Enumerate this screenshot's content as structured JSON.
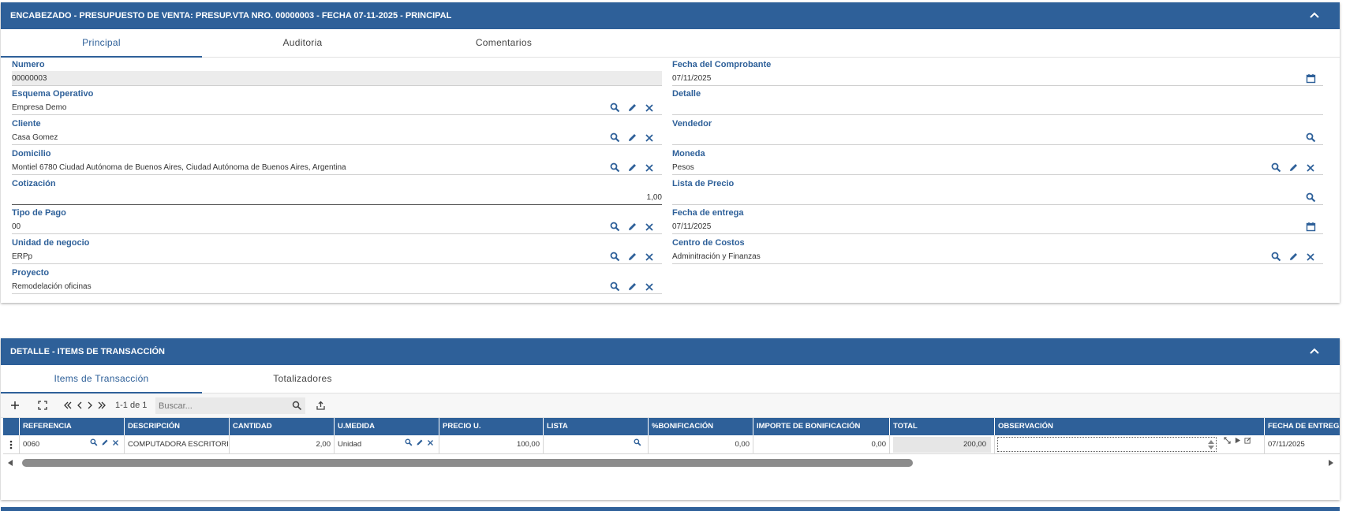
{
  "header_panel": {
    "title": "ENCABEZADO - PRESUPUESTO DE VENTA: PRESUP.VTA NRO. 00000003 - FECHA 07-11-2025 - PRINCIPAL",
    "tabs": [
      {
        "label": "Principal",
        "active": true
      },
      {
        "label": "Auditoria",
        "active": false
      },
      {
        "label": "Comentarios",
        "active": false
      }
    ],
    "left_fields": [
      {
        "label": "Numero",
        "value": "00000003"
      },
      {
        "label": "Esquema Operativo",
        "value": "Empresa Demo"
      },
      {
        "label": "Cliente",
        "value": "Casa Gomez"
      },
      {
        "label": "Domicilio",
        "value": "Montiel 6780  Ciudad Autónoma de Buenos Aires, Ciudad Autónoma de Buenos Aires, Argentina"
      },
      {
        "label": "Cotización",
        "value": "1,00"
      },
      {
        "label": "Tipo de Pago",
        "value": "00"
      },
      {
        "label": "Unidad de negocio",
        "value": "ERPp"
      },
      {
        "label": "Proyecto",
        "value": "Remodelación oficinas"
      }
    ],
    "right_fields": [
      {
        "label": "Fecha del Comprobante",
        "value": "07/11/2025"
      },
      {
        "label": "Detalle",
        "value": ""
      },
      {
        "label": "Vendedor",
        "value": ""
      },
      {
        "label": "Moneda",
        "value": "Pesos"
      },
      {
        "label": "Lista de Precio",
        "value": ""
      },
      {
        "label": "Fecha de entrega",
        "value": "07/11/2025"
      },
      {
        "label": "Centro de Costos",
        "value": "Adminitración y Finanzas"
      }
    ]
  },
  "detail_panel": {
    "title": "DETALLE - ITEMS DE TRANSACCIÓN",
    "tabs": [
      {
        "label": "Items de Transacción",
        "active": true
      },
      {
        "label": "Totalizadores",
        "active": false
      }
    ],
    "toolbar": {
      "pagination": "1-1 de 1",
      "search_placeholder": "Buscar..."
    },
    "columns": [
      "REFERENCIA",
      "DESCRIPCIÓN",
      "CANTIDAD",
      "U.MEDIDA",
      "PRECIO U.",
      "LISTA",
      "%BONIFICACIÓN",
      "IMPORTE DE BONIFICACIÓN",
      "TOTAL",
      "OBSERVACIÓN",
      "FECHA DE ENTREGA"
    ],
    "rows": [
      {
        "referencia": "0060",
        "descripcion": "COMPUTADORA ESCRITORIO",
        "cantidad": "2,00",
        "umedida": "Unidad",
        "precio": "100,00",
        "lista": "",
        "bonificacion": "0,00",
        "importe_bonificacion": "0,00",
        "total": "200,00",
        "observacion": "",
        "fecha_entrega": "07/11/2025"
      }
    ]
  },
  "colors": {
    "accent": "#2e6099"
  }
}
